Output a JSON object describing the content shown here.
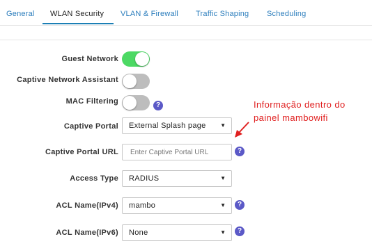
{
  "tabs": [
    {
      "label": "General"
    },
    {
      "label": "WLAN Security"
    },
    {
      "label": "VLAN & Firewall"
    },
    {
      "label": "Traffic Shaping"
    },
    {
      "label": "Scheduling"
    }
  ],
  "active_tab": "WLAN Security",
  "form": {
    "guest_network": {
      "label": "Guest Network",
      "enabled": true
    },
    "captive_network_assistant": {
      "label": "Captive Network Assistant",
      "enabled": false
    },
    "mac_filtering": {
      "label": "MAC Filtering",
      "enabled": false
    },
    "captive_portal": {
      "label": "Captive Portal",
      "value": "External Splash page"
    },
    "captive_portal_url": {
      "label": "Captive Portal URL",
      "value": "",
      "placeholder": "Enter Captive Portal URL"
    },
    "access_type": {
      "label": "Access Type",
      "value": "RADIUS"
    },
    "acl_ipv4": {
      "label": "ACL Name(IPv4)",
      "value": "mambo"
    },
    "acl_ipv6": {
      "label": "ACL Name(IPv6)",
      "value": "None"
    }
  },
  "help_glyph": "?",
  "caret_glyph": "▼",
  "annotation": {
    "line1": "Informação dentro do",
    "line2": "painel mambowifi",
    "color": "#e02020"
  },
  "colors": {
    "accent": "#1c7fb5",
    "toggle_on": "#4cd964",
    "toggle_off": "#bdbdbd",
    "help": "#5b59c7"
  },
  "icons": [
    "help-icon",
    "dropdown-caret-icon",
    "red-arrow-icon"
  ]
}
